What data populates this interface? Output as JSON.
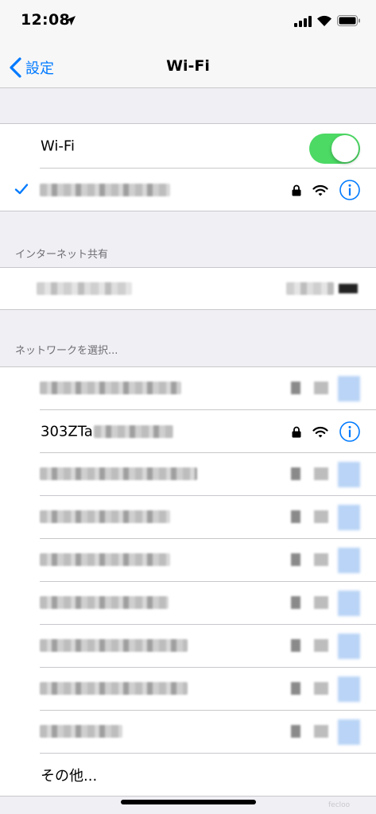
{
  "status_bar": {
    "time": "12:08"
  },
  "nav": {
    "back_label": "設定",
    "title": "Wi-Fi"
  },
  "wifi": {
    "label": "Wi-Fi",
    "enabled": true
  },
  "hotspot_section": {
    "header": "インターネット共有"
  },
  "networks_section": {
    "header": "ネットワークを選択..."
  },
  "networks": [
    {
      "name_visible": "303ZTa"
    }
  ],
  "other_label": "その他...",
  "watermark": "fecloo",
  "colors": {
    "accent": "#007aff",
    "toggle_on": "#4cd964",
    "background": "#efeff4"
  }
}
